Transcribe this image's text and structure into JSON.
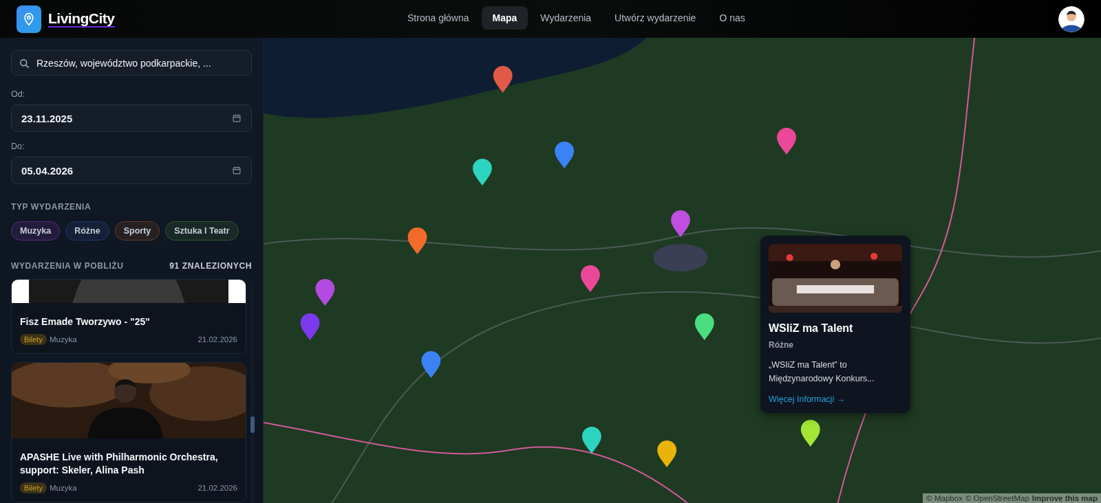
{
  "header": {
    "logo": "LivingCity",
    "nav": [
      {
        "label": "Strona główna",
        "selected": false
      },
      {
        "label": "Mapa",
        "selected": true
      },
      {
        "label": "Wydarzenia",
        "selected": false
      },
      {
        "label": "Utwórz wydarzenie",
        "selected": false
      },
      {
        "label": "O nas",
        "selected": false
      }
    ]
  },
  "sidebar": {
    "search": {
      "value": "Rzeszów, województwo podkarpackie, ..."
    },
    "date_from": {
      "label": "Od:",
      "value": "23.11.2025"
    },
    "date_to": {
      "label": "Do:",
      "value": "05.04.2026"
    },
    "type_heading": "TYP WYDARZENIA",
    "types": [
      {
        "label": "Muzyka",
        "color": "#5b2a86"
      },
      {
        "label": "Różne",
        "color": "#1e3a6e"
      },
      {
        "label": "Sporty",
        "color": "#6b3a24"
      },
      {
        "label": "Sztuka I Teatr",
        "color": "#2f5a2a"
      }
    ],
    "nearby_heading": "WYDARZENIA W POBLIŻU",
    "nearby_count": "91 ZNALEZIONYCH",
    "events": [
      {
        "kind": "picture",
        "title": "Fisz Emade Tworzywo - \"25\"",
        "badge": "Bilety",
        "category": "Muzyka",
        "date": "21.02.2026"
      },
      {
        "kind": "picture",
        "title": "APASHE Live with Philharmonic Orchestra, support: Skeler, Alina Pash",
        "badge": "Bilety",
        "category": "Muzyka",
        "date": "21.02.2026"
      }
    ]
  },
  "map": {
    "kind": "picture",
    "popup": {
      "title": "WSIiZ ma Talent",
      "category": "Różne",
      "description": "„WSIiZ ma Talent” to Międzynarodowy Konkurs...",
      "link": "Więcej Informacji →"
    },
    "attribution": [
      "© Mapbox",
      "© OpenStreetMap",
      "Improve this map"
    ]
  }
}
